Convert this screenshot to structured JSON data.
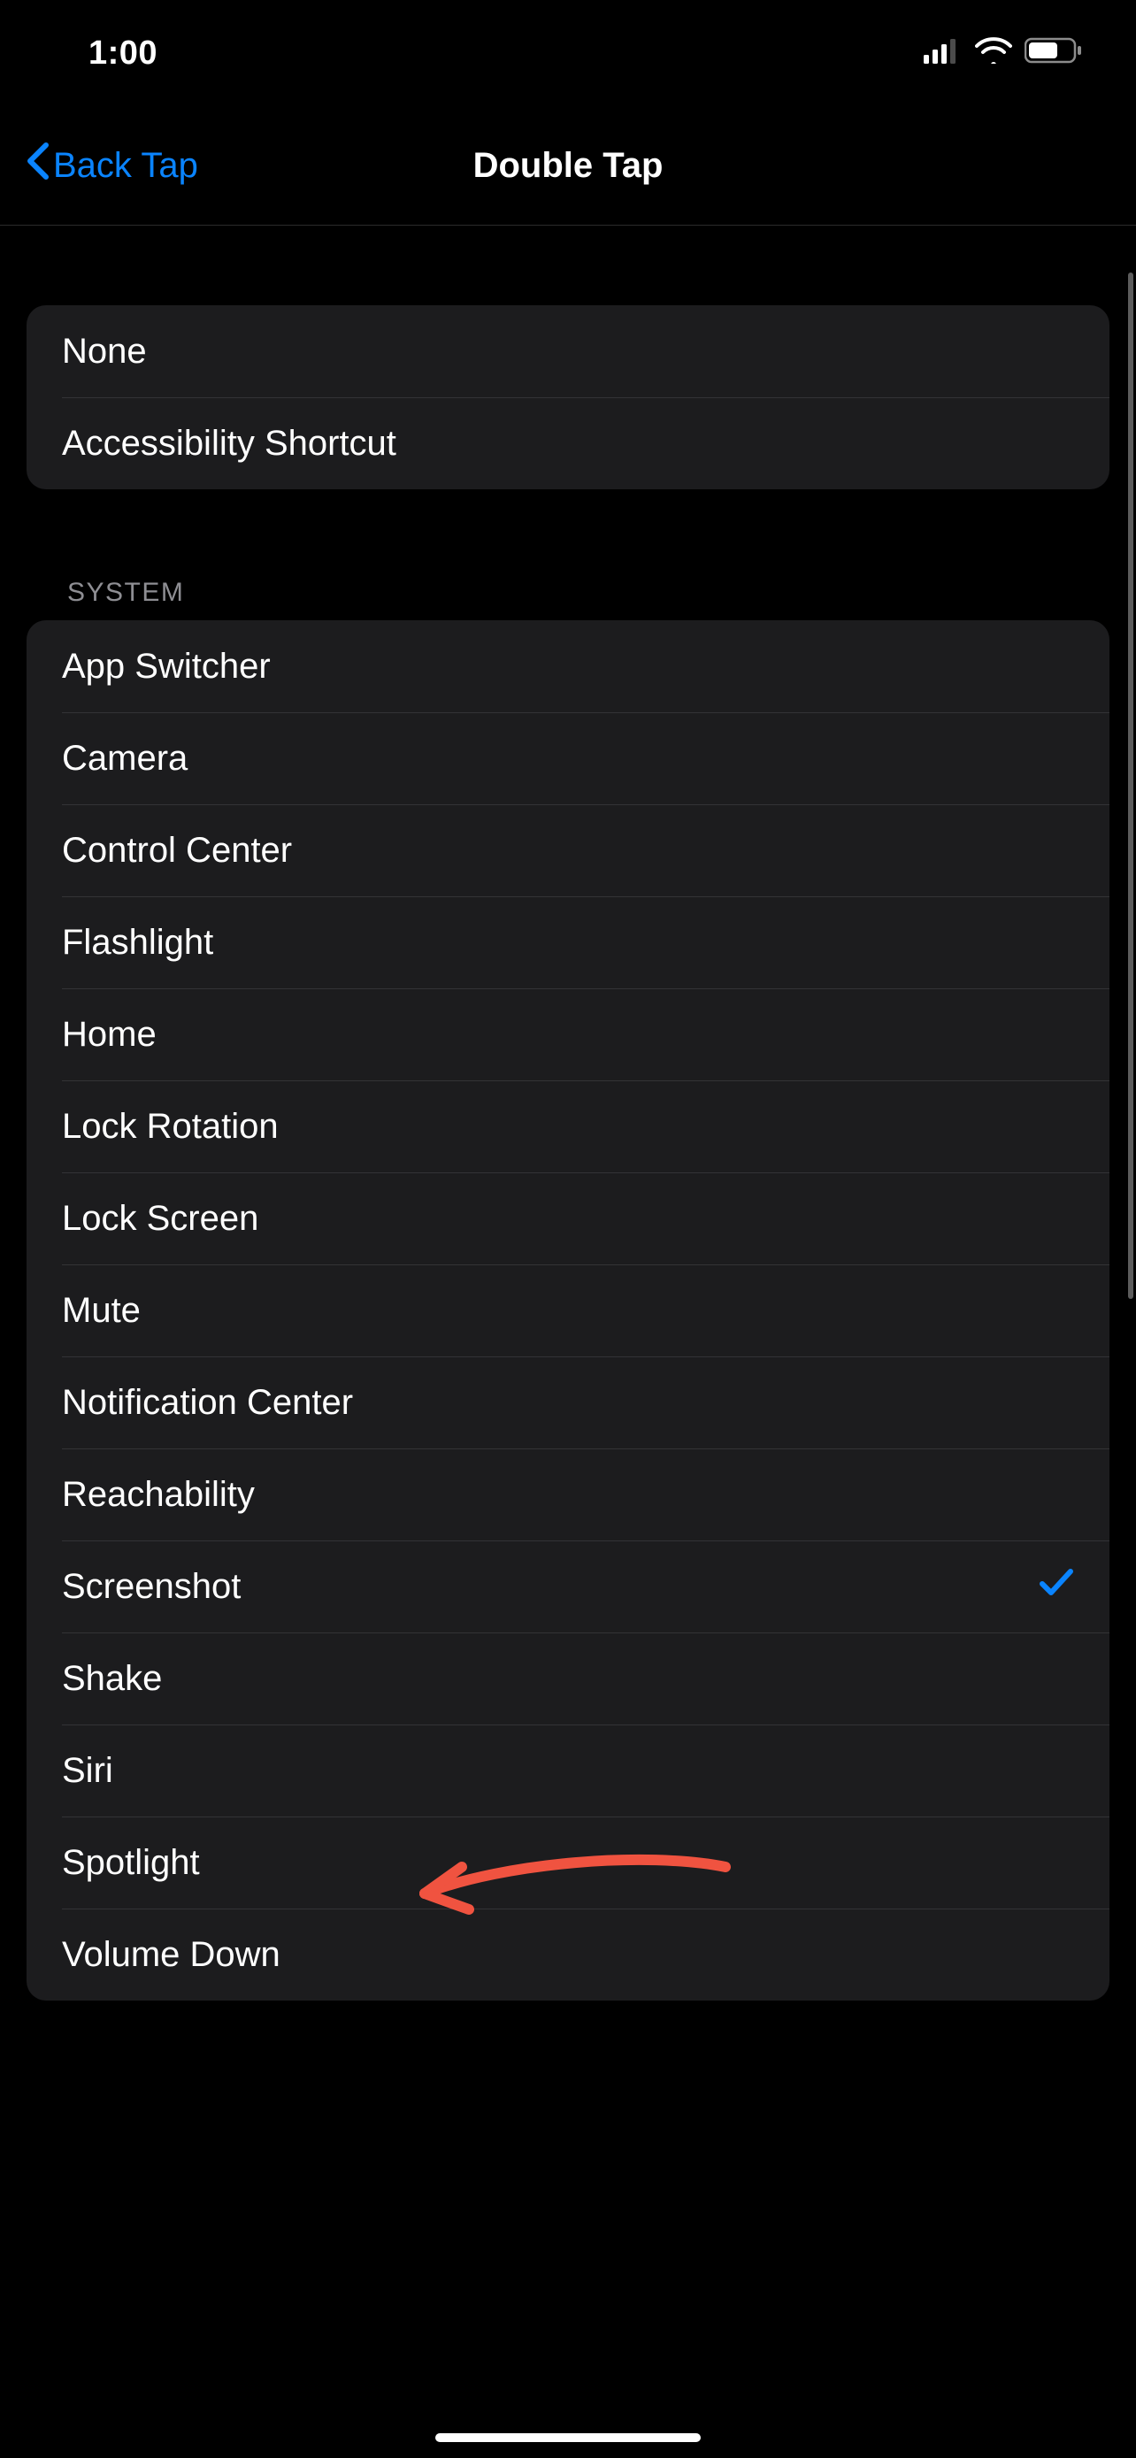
{
  "status_bar": {
    "time": "1:00"
  },
  "nav": {
    "back_label": "Back Tap",
    "title": "Double Tap"
  },
  "groups": {
    "first": [
      {
        "label": "None",
        "selected": false
      },
      {
        "label": "Accessibility Shortcut",
        "selected": false
      }
    ],
    "system_header": "SYSTEM",
    "system": [
      {
        "label": "App Switcher",
        "selected": false
      },
      {
        "label": "Camera",
        "selected": false
      },
      {
        "label": "Control Center",
        "selected": false
      },
      {
        "label": "Flashlight",
        "selected": false
      },
      {
        "label": "Home",
        "selected": false
      },
      {
        "label": "Lock Rotation",
        "selected": false
      },
      {
        "label": "Lock Screen",
        "selected": false
      },
      {
        "label": "Mute",
        "selected": false
      },
      {
        "label": "Notification Center",
        "selected": false
      },
      {
        "label": "Reachability",
        "selected": false
      },
      {
        "label": "Screenshot",
        "selected": true
      },
      {
        "label": "Shake",
        "selected": false
      },
      {
        "label": "Siri",
        "selected": false
      },
      {
        "label": "Spotlight",
        "selected": false
      },
      {
        "label": "Volume Down",
        "selected": false
      }
    ]
  },
  "colors": {
    "accent": "#0a84ff",
    "annotation": "#f05340"
  },
  "annotation": {
    "target_row": "Screenshot"
  }
}
